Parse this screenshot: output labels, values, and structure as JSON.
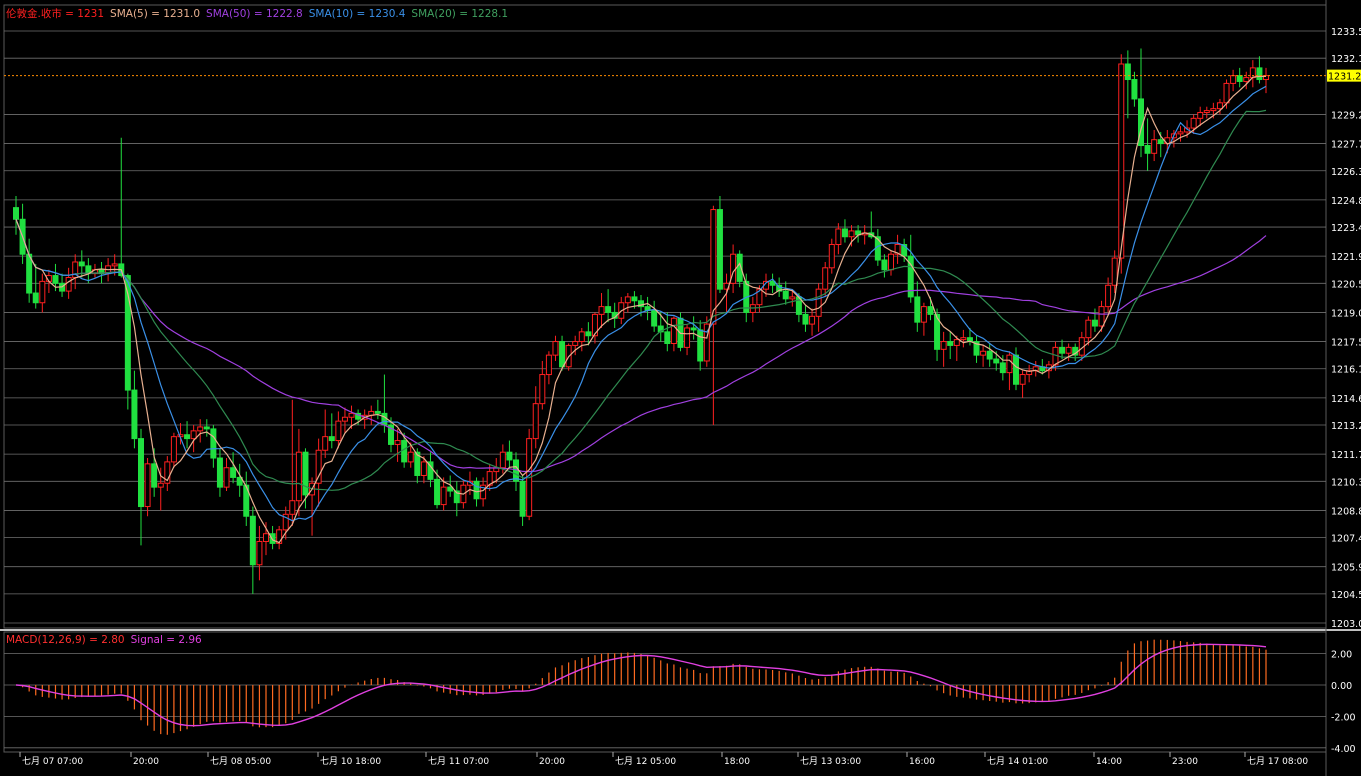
{
  "legend_main": [
    {
      "text": "伦敦金.收市 = 1231",
      "color": "#ff2020"
    },
    {
      "text": "SMA(5) = 1231.0",
      "color": "#e8b090"
    },
    {
      "text": "SMA(50) = 1222.8",
      "color": "#a040e0"
    },
    {
      "text": "SMA(10) = 1230.4",
      "color": "#3a90e8"
    },
    {
      "text": "SMA(20) = 1228.1",
      "color": "#40a060"
    }
  ],
  "legend_macd": [
    {
      "text": "MACD(12,26,9) = 2.80",
      "color": "#ff3030"
    },
    {
      "text": "Signal = 2.96",
      "color": "#e040e0"
    }
  ],
  "last_price_label": "1231.2",
  "colors": {
    "up": "#ff2020",
    "down": "#20e040",
    "grid": "#707070",
    "axis_text": "#ffffff",
    "price_line": "#ff8c00",
    "price_tag_bg": "#ffff00",
    "macd_hist": "#ff6a20",
    "signal": "#e040e0"
  },
  "chart_data": [
    {
      "type": "candlestick",
      "title": "伦敦金.收市",
      "y_ticks": [
        "1233.5",
        "1232.1",
        "1229.2",
        "1227.7",
        "1226.3",
        "1224.8",
        "1223.4",
        "1221.9",
        "1220.5",
        "1219.0",
        "1217.5",
        "1216.1",
        "1214.6",
        "1213.2",
        "1211.7",
        "1210.3",
        "1208.8",
        "1207.4",
        "1205.9",
        "1204.5",
        "1203.0"
      ],
      "ylim": [
        1203.0,
        1233.5
      ],
      "x_tick_labels": [
        "七月 07 07:00",
        "20:00",
        "七月 08 05:00",
        "七月 10 18:00",
        "七月 11 07:00",
        "20:00",
        "七月 12 05:00",
        "18:00",
        "七月 13 03:00",
        "16:00",
        "七月 14 01:00",
        "14:00",
        "23:00",
        "七月 17 08:00"
      ],
      "last_price": 1231.2,
      "candles": [
        [
          1224.4,
          1225.0,
          1223.0,
          1223.8
        ],
        [
          1223.8,
          1224.6,
          1221.5,
          1222.0
        ],
        [
          1222.0,
          1222.8,
          1219.5,
          1220.0
        ],
        [
          1220.0,
          1221.5,
          1219.2,
          1219.5
        ],
        [
          1219.5,
          1221.0,
          1219.0,
          1220.6
        ],
        [
          1220.6,
          1221.2,
          1220.0,
          1220.9
        ],
        [
          1220.9,
          1221.5,
          1220.1,
          1220.5
        ],
        [
          1220.5,
          1221.0,
          1219.8,
          1220.1
        ],
        [
          1220.1,
          1221.3,
          1219.7,
          1220.8
        ],
        [
          1220.8,
          1222.0,
          1220.2,
          1221.6
        ],
        [
          1221.6,
          1222.2,
          1220.8,
          1221.4
        ],
        [
          1221.4,
          1221.8,
          1220.5,
          1221.0
        ],
        [
          1221.0,
          1221.5,
          1220.8,
          1221.2
        ],
        [
          1221.2,
          1221.6,
          1220.5,
          1221.0
        ],
        [
          1221.0,
          1221.8,
          1220.6,
          1221.4
        ],
        [
          1221.4,
          1222.0,
          1220.9,
          1221.5
        ],
        [
          1221.5,
          1228.0,
          1220.8,
          1220.9
        ],
        [
          1220.9,
          1221.0,
          1214.0,
          1215.0
        ],
        [
          1215.0,
          1216.0,
          1212.0,
          1212.5
        ],
        [
          1212.5,
          1213.0,
          1207.0,
          1209.0
        ],
        [
          1209.0,
          1211.5,
          1208.5,
          1211.2
        ],
        [
          1211.2,
          1212.0,
          1209.5,
          1210.0
        ],
        [
          1210.0,
          1211.0,
          1208.8,
          1210.2
        ],
        [
          1210.2,
          1211.6,
          1209.8,
          1211.3
        ],
        [
          1211.3,
          1212.8,
          1211.0,
          1212.6
        ],
        [
          1212.6,
          1213.3,
          1212.2,
          1212.7
        ],
        [
          1212.7,
          1213.4,
          1212.0,
          1212.5
        ],
        [
          1212.5,
          1213.2,
          1211.8,
          1212.9
        ],
        [
          1212.9,
          1213.5,
          1212.3,
          1213.1
        ],
        [
          1213.1,
          1213.5,
          1212.6,
          1213.0
        ],
        [
          1213.0,
          1213.2,
          1211.0,
          1211.5
        ],
        [
          1211.5,
          1212.0,
          1209.5,
          1210.0
        ],
        [
          1210.0,
          1211.5,
          1209.8,
          1211.0
        ],
        [
          1211.0,
          1211.8,
          1210.2,
          1210.5
        ],
        [
          1210.5,
          1211.2,
          1209.5,
          1210.1
        ],
        [
          1210.1,
          1210.8,
          1208.0,
          1208.5
        ],
        [
          1208.5,
          1209.0,
          1204.5,
          1206.0
        ],
        [
          1206.0,
          1208.0,
          1205.2,
          1207.2
        ],
        [
          1207.2,
          1208.2,
          1206.5,
          1207.6
        ],
        [
          1207.6,
          1208.0,
          1206.8,
          1207.1
        ],
        [
          1207.1,
          1208.0,
          1206.8,
          1207.8
        ],
        [
          1207.8,
          1209.0,
          1207.3,
          1208.6
        ],
        [
          1208.6,
          1214.5,
          1208.0,
          1209.3
        ],
        [
          1209.3,
          1213.0,
          1208.5,
          1211.8
        ],
        [
          1211.8,
          1212.0,
          1208.9,
          1209.6
        ],
        [
          1209.6,
          1210.5,
          1207.5,
          1210.2
        ],
        [
          1210.2,
          1212.5,
          1209.0,
          1211.9
        ],
        [
          1211.9,
          1214.0,
          1211.5,
          1212.6
        ],
        [
          1212.6,
          1213.8,
          1212.0,
          1212.4
        ],
        [
          1212.4,
          1213.9,
          1212.0,
          1213.4
        ],
        [
          1213.4,
          1214.1,
          1212.8,
          1213.6
        ],
        [
          1213.6,
          1214.2,
          1213.0,
          1213.8
        ],
        [
          1213.8,
          1214.0,
          1213.2,
          1213.5
        ],
        [
          1213.5,
          1214.0,
          1213.0,
          1213.7
        ],
        [
          1213.7,
          1214.2,
          1213.2,
          1213.9
        ],
        [
          1213.9,
          1214.5,
          1213.5,
          1213.8
        ],
        [
          1213.8,
          1215.8,
          1212.8,
          1213.2
        ],
        [
          1213.2,
          1213.6,
          1211.8,
          1212.2
        ],
        [
          1212.2,
          1213.0,
          1211.3,
          1212.4
        ],
        [
          1212.4,
          1212.8,
          1211.0,
          1211.3
        ],
        [
          1211.3,
          1212.3,
          1211.0,
          1211.8
        ],
        [
          1211.8,
          1212.0,
          1210.2,
          1210.6
        ],
        [
          1210.6,
          1211.6,
          1210.2,
          1211.3
        ],
        [
          1211.3,
          1211.8,
          1210.0,
          1210.4
        ],
        [
          1210.4,
          1210.9,
          1208.9,
          1209.1
        ],
        [
          1209.1,
          1210.5,
          1208.8,
          1210.0
        ],
        [
          1210.0,
          1210.6,
          1209.5,
          1209.8
        ],
        [
          1209.8,
          1210.3,
          1208.5,
          1209.2
        ],
        [
          1209.2,
          1210.4,
          1208.9,
          1210.1
        ],
        [
          1210.1,
          1210.8,
          1209.6,
          1210.3
        ],
        [
          1210.3,
          1210.5,
          1209.0,
          1209.4
        ],
        [
          1209.4,
          1210.5,
          1209.0,
          1210.1
        ],
        [
          1210.1,
          1211.2,
          1209.8,
          1210.8
        ],
        [
          1210.8,
          1211.5,
          1210.2,
          1211.0
        ],
        [
          1211.0,
          1212.2,
          1210.7,
          1211.8
        ],
        [
          1211.8,
          1212.4,
          1211.0,
          1211.4
        ],
        [
          1211.4,
          1211.8,
          1209.8,
          1210.3
        ],
        [
          1210.3,
          1210.6,
          1208.0,
          1208.5
        ],
        [
          1208.5,
          1213.0,
          1208.3,
          1212.5
        ],
        [
          1212.5,
          1215.2,
          1212.0,
          1214.3
        ],
        [
          1214.3,
          1216.5,
          1214.0,
          1215.8
        ],
        [
          1215.8,
          1217.0,
          1215.3,
          1216.8
        ],
        [
          1216.8,
          1217.8,
          1216.5,
          1217.5
        ],
        [
          1217.5,
          1217.8,
          1216.0,
          1216.2
        ],
        [
          1216.2,
          1217.4,
          1216.0,
          1217.3
        ],
        [
          1217.3,
          1217.8,
          1216.8,
          1217.5
        ],
        [
          1217.5,
          1218.2,
          1217.0,
          1218.0
        ],
        [
          1218.0,
          1218.5,
          1217.3,
          1217.8
        ],
        [
          1217.8,
          1219.0,
          1217.4,
          1218.9
        ],
        [
          1218.9,
          1220.0,
          1218.2,
          1219.3
        ],
        [
          1219.3,
          1220.2,
          1218.5,
          1219.0
        ],
        [
          1219.0,
          1219.5,
          1218.2,
          1218.7
        ],
        [
          1218.7,
          1219.8,
          1218.4,
          1219.5
        ],
        [
          1219.5,
          1220.0,
          1219.0,
          1219.8
        ],
        [
          1219.8,
          1220.1,
          1219.2,
          1219.6
        ],
        [
          1219.6,
          1219.9,
          1218.8,
          1219.3
        ],
        [
          1219.3,
          1219.8,
          1218.6,
          1219.1
        ],
        [
          1219.1,
          1219.6,
          1218.0,
          1218.3
        ],
        [
          1218.3,
          1219.0,
          1217.5,
          1218.0
        ],
        [
          1218.0,
          1219.0,
          1217.0,
          1217.4
        ],
        [
          1217.4,
          1218.8,
          1217.0,
          1218.7
        ],
        [
          1218.7,
          1219.0,
          1217.0,
          1217.2
        ],
        [
          1217.2,
          1218.4,
          1216.8,
          1218.2
        ],
        [
          1218.2,
          1218.8,
          1217.6,
          1218.1
        ],
        [
          1218.1,
          1218.6,
          1216.0,
          1216.5
        ],
        [
          1216.5,
          1218.8,
          1216.2,
          1218.4
        ],
        [
          1218.4,
          1224.5,
          1213.2,
          1224.3
        ],
        [
          1224.3,
          1225.0,
          1220.0,
          1220.2
        ],
        [
          1220.2,
          1221.0,
          1219.0,
          1220.5
        ],
        [
          1220.5,
          1222.5,
          1220.0,
          1222.0
        ],
        [
          1222.0,
          1222.2,
          1220.3,
          1220.6
        ],
        [
          1220.6,
          1221.0,
          1218.5,
          1219.0
        ],
        [
          1219.0,
          1219.8,
          1218.5,
          1219.4
        ],
        [
          1219.4,
          1220.4,
          1219.0,
          1220.2
        ],
        [
          1220.2,
          1221.0,
          1219.8,
          1220.6
        ],
        [
          1220.6,
          1221.0,
          1220.0,
          1220.4
        ],
        [
          1220.4,
          1220.8,
          1219.8,
          1220.1
        ],
        [
          1220.1,
          1220.6,
          1219.4,
          1219.7
        ],
        [
          1219.7,
          1220.2,
          1219.3,
          1219.8
        ],
        [
          1219.8,
          1220.0,
          1218.5,
          1218.9
        ],
        [
          1218.9,
          1219.4,
          1218.0,
          1218.4
        ],
        [
          1218.4,
          1219.2,
          1217.8,
          1218.8
        ],
        [
          1218.8,
          1220.5,
          1218.0,
          1220.2
        ],
        [
          1220.2,
          1221.6,
          1219.8,
          1221.3
        ],
        [
          1221.3,
          1222.8,
          1221.0,
          1222.5
        ],
        [
          1222.5,
          1223.6,
          1222.0,
          1223.3
        ],
        [
          1223.3,
          1223.8,
          1222.6,
          1222.9
        ],
        [
          1222.9,
          1223.5,
          1222.4,
          1223.2
        ],
        [
          1223.2,
          1223.5,
          1222.6,
          1223.0
        ],
        [
          1223.0,
          1223.5,
          1222.5,
          1223.1
        ],
        [
          1223.1,
          1224.2,
          1222.8,
          1222.9
        ],
        [
          1222.9,
          1223.3,
          1221.4,
          1221.7
        ],
        [
          1221.7,
          1222.0,
          1220.8,
          1221.2
        ],
        [
          1221.2,
          1222.2,
          1220.9,
          1222.0
        ],
        [
          1222.0,
          1223.0,
          1221.5,
          1222.5
        ],
        [
          1222.5,
          1222.8,
          1221.6,
          1221.9
        ],
        [
          1221.9,
          1223.0,
          1219.5,
          1219.8
        ],
        [
          1219.8,
          1220.6,
          1218.0,
          1218.5
        ],
        [
          1218.5,
          1219.5,
          1217.8,
          1219.3
        ],
        [
          1219.3,
          1219.8,
          1218.6,
          1218.9
        ],
        [
          1218.9,
          1219.2,
          1216.5,
          1217.1
        ],
        [
          1217.1,
          1218.0,
          1216.2,
          1217.5
        ],
        [
          1217.5,
          1218.0,
          1216.6,
          1217.3
        ],
        [
          1217.3,
          1217.8,
          1216.5,
          1217.6
        ],
        [
          1217.6,
          1218.1,
          1217.2,
          1217.7
        ],
        [
          1217.7,
          1218.2,
          1217.3,
          1217.5
        ],
        [
          1217.5,
          1217.8,
          1216.4,
          1216.8
        ],
        [
          1216.8,
          1217.3,
          1216.2,
          1217.0
        ],
        [
          1217.0,
          1217.4,
          1216.2,
          1216.6
        ],
        [
          1216.6,
          1217.0,
          1216.0,
          1216.4
        ],
        [
          1216.4,
          1216.8,
          1215.5,
          1215.9
        ],
        [
          1215.9,
          1217.0,
          1215.0,
          1216.8
        ],
        [
          1216.8,
          1217.2,
          1215.0,
          1215.3
        ],
        [
          1215.3,
          1216.0,
          1214.6,
          1215.8
        ],
        [
          1215.8,
          1216.3,
          1215.4,
          1216.0
        ],
        [
          1216.0,
          1216.5,
          1215.7,
          1216.2
        ],
        [
          1216.2,
          1216.6,
          1215.8,
          1216.0
        ],
        [
          1216.0,
          1216.5,
          1215.6,
          1216.3
        ],
        [
          1216.3,
          1217.5,
          1216.0,
          1217.2
        ],
        [
          1217.2,
          1217.6,
          1216.6,
          1216.9
        ],
        [
          1216.9,
          1217.4,
          1216.5,
          1217.2
        ],
        [
          1217.2,
          1217.4,
          1216.5,
          1216.8
        ],
        [
          1216.8,
          1218.0,
          1216.5,
          1217.7
        ],
        [
          1217.7,
          1218.8,
          1217.3,
          1218.6
        ],
        [
          1218.6,
          1219.2,
          1218.0,
          1218.3
        ],
        [
          1218.3,
          1219.6,
          1218.0,
          1219.3
        ],
        [
          1219.3,
          1220.8,
          1219.0,
          1220.4
        ],
        [
          1220.4,
          1222.2,
          1220.0,
          1221.8
        ],
        [
          1221.8,
          1232.3,
          1221.0,
          1231.8
        ],
        [
          1231.8,
          1232.5,
          1229.0,
          1231.0
        ],
        [
          1231.0,
          1231.4,
          1229.6,
          1230.0
        ],
        [
          1230.0,
          1232.6,
          1227.0,
          1227.6
        ],
        [
          1227.6,
          1229.0,
          1226.3,
          1227.2
        ],
        [
          1227.2,
          1228.4,
          1226.8,
          1227.9
        ],
        [
          1227.9,
          1228.3,
          1227.0,
          1227.7
        ],
        [
          1227.7,
          1228.4,
          1227.2,
          1228.0
        ],
        [
          1228.0,
          1228.4,
          1227.5,
          1228.2
        ],
        [
          1228.2,
          1228.6,
          1227.8,
          1228.3
        ],
        [
          1228.3,
          1228.9,
          1228.0,
          1228.5
        ],
        [
          1228.5,
          1229.2,
          1228.2,
          1229.0
        ],
        [
          1229.0,
          1229.6,
          1228.6,
          1229.3
        ],
        [
          1229.3,
          1229.6,
          1229.0,
          1229.4
        ],
        [
          1229.4,
          1229.8,
          1229.0,
          1229.5
        ],
        [
          1229.5,
          1230.0,
          1229.2,
          1229.8
        ],
        [
          1229.8,
          1231.0,
          1229.5,
          1230.8
        ],
        [
          1230.8,
          1231.5,
          1230.4,
          1231.2
        ],
        [
          1231.2,
          1231.6,
          1230.6,
          1230.9
        ],
        [
          1230.9,
          1231.4,
          1230.5,
          1231.1
        ],
        [
          1231.1,
          1232.0,
          1230.6,
          1231.6
        ],
        [
          1231.6,
          1232.2,
          1230.8,
          1231.0
        ],
        [
          1231.0,
          1231.6,
          1230.3,
          1231.2
        ]
      ],
      "sma": [
        {
          "name": "SMA(5)",
          "value": 1231.0
        },
        {
          "name": "SMA(10)",
          "value": 1230.4
        },
        {
          "name": "SMA(20)",
          "value": 1228.1
        },
        {
          "name": "SMA(50)",
          "value": 1222.8
        }
      ]
    },
    {
      "type": "bar",
      "title": "MACD(12,26,9)",
      "y_ticks": [
        "2.00",
        "0.00",
        "-2.00",
        "-4.00"
      ],
      "ylim": [
        -4.2,
        3.0
      ],
      "macd_value": 2.8,
      "signal_value": 2.96
    }
  ]
}
